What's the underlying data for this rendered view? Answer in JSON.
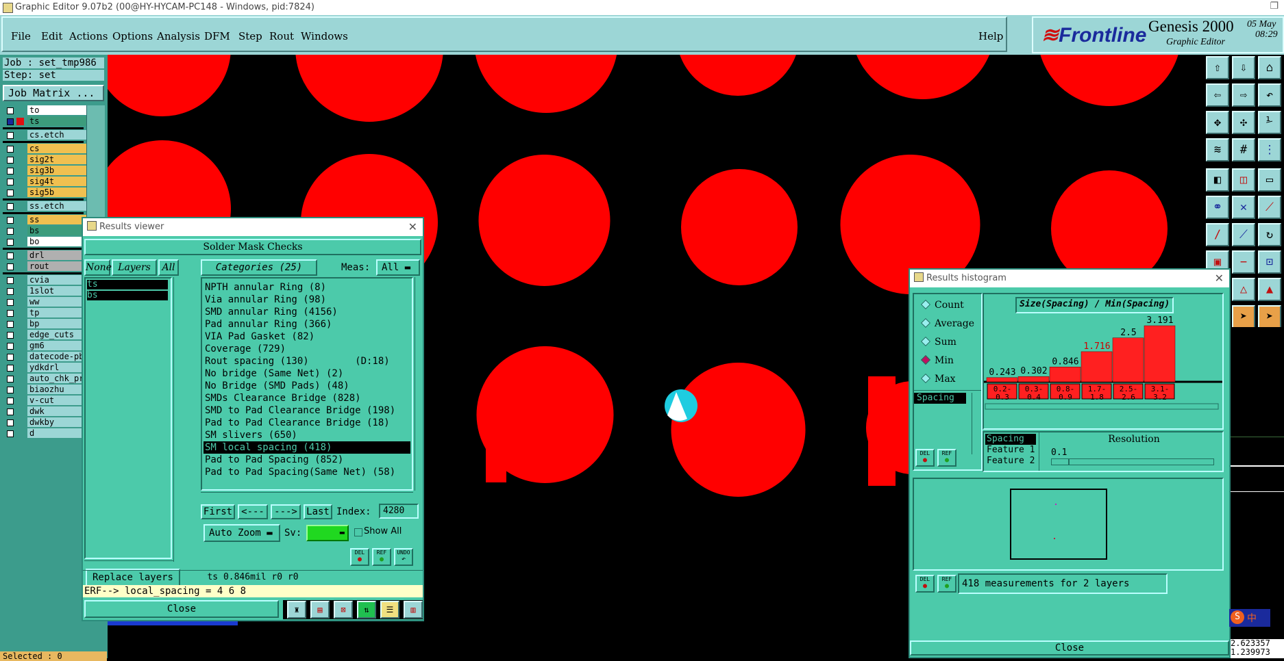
{
  "window": {
    "title": "Graphic Editor 9.07b2 (00@HY-HYCAM-PC148 - Windows, pid:7824)"
  },
  "menu": {
    "items": [
      "File",
      "Edit",
      "Actions",
      "Options",
      "Analysis",
      "DFM",
      "Step",
      "Rout",
      "Windows"
    ],
    "help": "Help"
  },
  "brand": {
    "logo": "Frontline",
    "product": "Genesis 2000",
    "subtitle": "Graphic Editor",
    "date": "05 May",
    "time": "08:29"
  },
  "left_panel": {
    "job": "Job : set_tmp986",
    "step": "Step: set",
    "job_matrix": "Job Matrix ...",
    "layers": [
      {
        "name": "to",
        "color": "#ffffff"
      },
      {
        "name": "ts",
        "color": "#3c9c7c",
        "active": true
      },
      {
        "name": "cs.etch",
        "color": "#9cd6d6"
      },
      {
        "name": "cs",
        "color": "#f0c050"
      },
      {
        "name": "sig2t",
        "color": "#f0c050"
      },
      {
        "name": "sig3b",
        "color": "#f0c050"
      },
      {
        "name": "sig4t",
        "color": "#f0c050"
      },
      {
        "name": "sig5b",
        "color": "#f0c050"
      },
      {
        "name": "ss.etch",
        "color": "#9cd6d6"
      },
      {
        "name": "ss",
        "color": "#f0c050"
      },
      {
        "name": "bs",
        "color": "#3c9c7c"
      },
      {
        "name": "bo",
        "color": "#ffffff"
      },
      {
        "name": "drl",
        "color": "#b0b0b0"
      },
      {
        "name": "rout",
        "color": "#b0b0b0"
      },
      {
        "name": "cvia",
        "color": "#9cd6d6"
      },
      {
        "name": "1slot",
        "color": "#9cd6d6"
      },
      {
        "name": "ww",
        "color": "#9cd6d6"
      },
      {
        "name": "tp",
        "color": "#9cd6d6"
      },
      {
        "name": "bp",
        "color": "#9cd6d6"
      },
      {
        "name": "edge_cuts",
        "color": "#9cd6d6"
      },
      {
        "name": "gm6",
        "color": "#9cd6d6"
      },
      {
        "name": "datecode-pb",
        "color": "#9cd6d6"
      },
      {
        "name": "ydkdrl",
        "color": "#9cd6d6"
      },
      {
        "name": "auto_chk_pr",
        "color": "#9cd6d6"
      },
      {
        "name": "biaozhu",
        "color": "#9cd6d6"
      },
      {
        "name": "v-cut",
        "color": "#9cd6d6"
      },
      {
        "name": "dwk",
        "color": "#9cd6d6"
      },
      {
        "name": "dwkby",
        "color": "#9cd6d6"
      },
      {
        "name": "d",
        "color": "#9cd6d6"
      }
    ],
    "selected": "Selected : 0"
  },
  "results_viewer": {
    "title": "Results viewer",
    "header": "Solder Mask Checks",
    "btn_none": "None",
    "btn_layers": "Layers",
    "btn_all": "All",
    "layer_items": [
      "ts",
      "bs"
    ],
    "categories_label": "Categories (25)",
    "meas_label": "Meas:",
    "meas_value": "All",
    "categories": [
      "NPTH annular Ring (8)",
      "Via annular Ring (98)",
      "SMD annular Ring (4156)",
      "Pad annular Ring (366)",
      "VIA Pad Gasket (82)",
      "Coverage (729)",
      "Rout spacing (130)        (D:18)",
      "No bridge (Same Net) (2)",
      "No Bridge (SMD Pads) (48)",
      "SMDs Clearance Bridge (828)",
      "SMD to Pad Clearance Bridge (198)",
      "Pad to Pad Clearance Bridge (18)",
      "SM slivers (650)",
      "SM local spacing (418)",
      "Pad to Pad Spacing (852)",
      "Pad to Pad Spacing(Same Net) (58)"
    ],
    "selected_index": 13,
    "nav": {
      "first": "First",
      "prev": "<---",
      "next": "--->",
      "last": "Last",
      "index_label": "Index:",
      "index_value": "4280"
    },
    "auto_zoom": "Auto Zoom",
    "sv_label": "Sv:",
    "show_all": "Show All",
    "replace_layers": "Replace layers",
    "icon_labels": [
      "DEL",
      "REF",
      "UNDO"
    ],
    "status": "ts 0.846mil  r0  r0",
    "erf": "ERF--> local_spacing = 4 6 8",
    "close": "Close"
  },
  "histogram": {
    "title": "Results histogram",
    "modes": [
      "Count",
      "Average",
      "Sum",
      "Min",
      "Max"
    ],
    "selected_mode": "Min",
    "list_item": "Spacing",
    "chart_title": "Size(Spacing) / Min(Spacing)",
    "resolution_label": "Resolution",
    "resolution_value": "0.1",
    "measure_list": [
      "Spacing",
      "Feature 1",
      "Feature 2"
    ],
    "icon_labels": [
      "DEL",
      "REF"
    ],
    "summary": "418 measurements for 2 layers",
    "close": "Close"
  },
  "chart_data": {
    "type": "bar",
    "title": "Size(Spacing) / Min(Spacing)",
    "categories": [
      "0.2-0.3",
      "0.3-0.4",
      "0.8-0.9",
      "1.7-1.8",
      "2.5-2.6",
      "3.1-3.2"
    ],
    "category_lines": [
      [
        "0.2-",
        "0.3"
      ],
      [
        "0.3-",
        "0.4"
      ],
      [
        "0.8-",
        "0.9"
      ],
      [
        "1.7-",
        "1.8"
      ],
      [
        "2.5-",
        "2.6"
      ],
      [
        "3.1-",
        "3.2"
      ]
    ],
    "values": [
      0.243,
      0.302,
      0.846,
      1.716,
      2.5,
      3.191
    ],
    "value_labels": [
      "0.243",
      "0.302",
      "0.846",
      "1.716",
      "2.5",
      "3.191"
    ],
    "ylim": [
      0,
      3.191
    ],
    "bar_color": "#ff2020"
  },
  "coords": {
    "x": "2.623357",
    "y": "1.239973"
  },
  "colors": {
    "pad": "#ff0000",
    "canvas": "#000000",
    "panel": "#4ccaaa",
    "highlight": "#1ecce0"
  }
}
